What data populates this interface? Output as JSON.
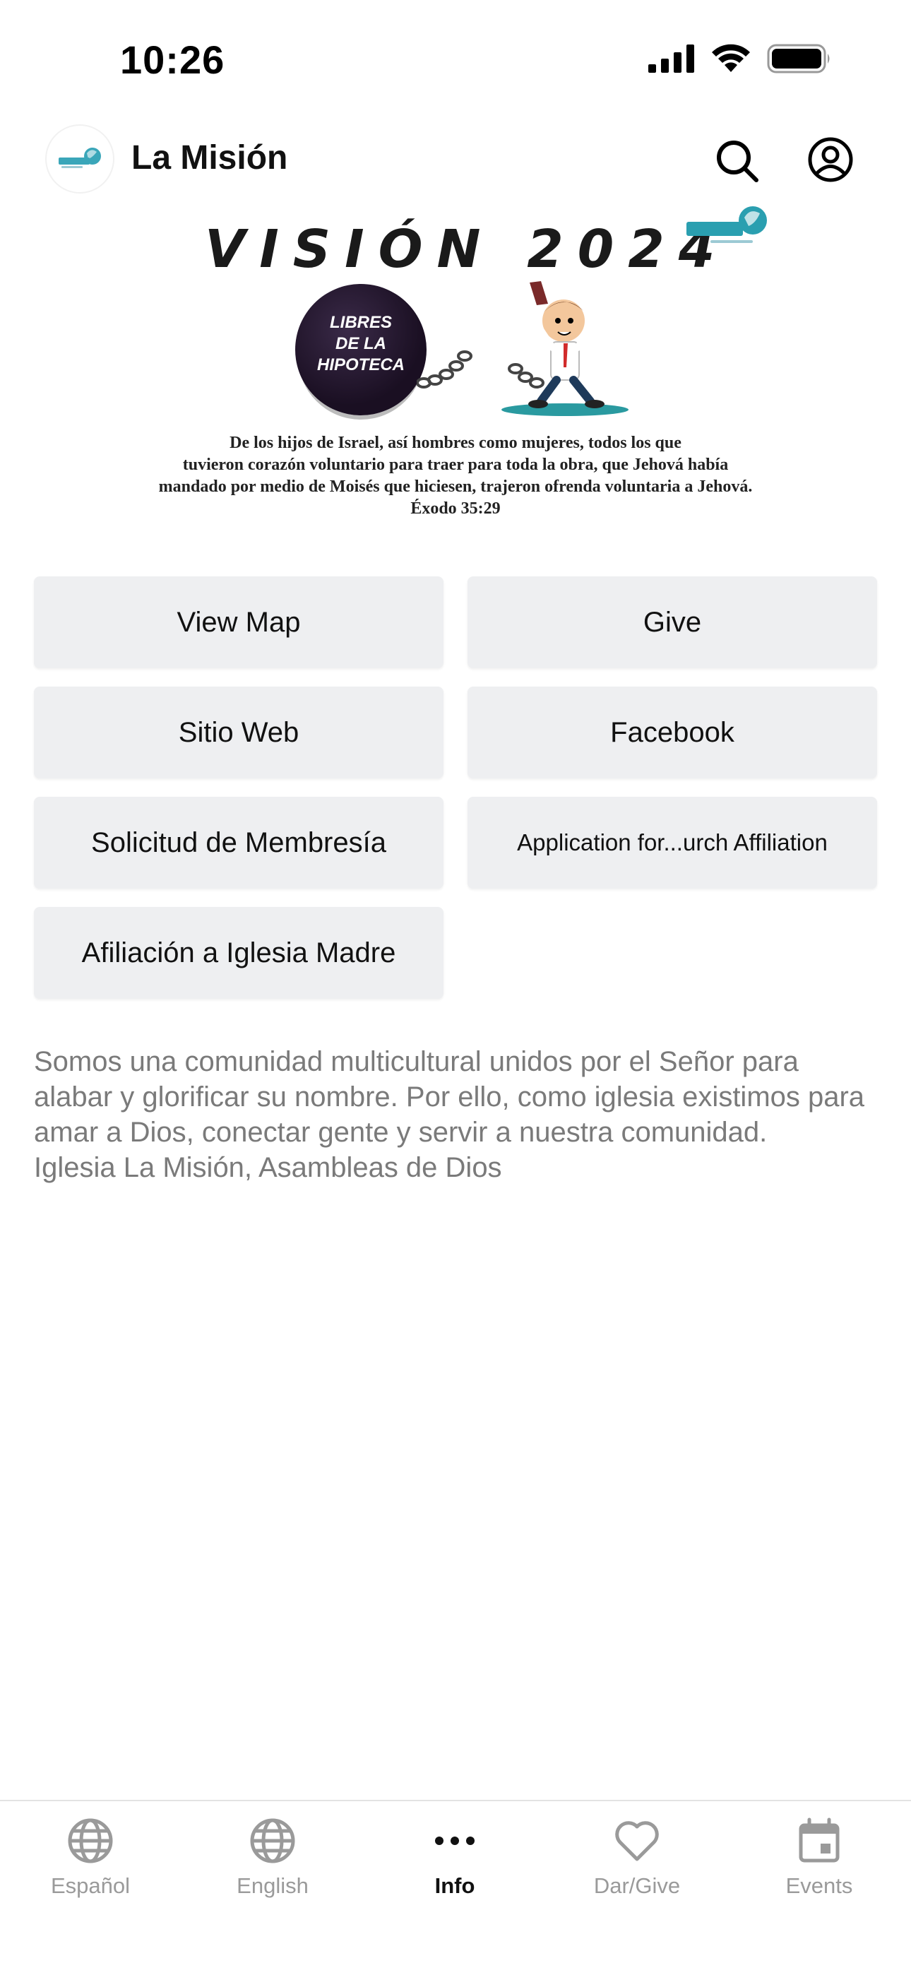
{
  "status_bar": {
    "time": "10:26"
  },
  "header": {
    "title": "La Misión"
  },
  "banner": {
    "title": "VISIÓN 2024",
    "ball_text": [
      "LIBRES",
      "DE LA",
      "HIPOTECA"
    ],
    "verse_lines": [
      "De los hijos de Israel, así hombres como mujeres, todos los que",
      "tuvieron corazón voluntario para traer para toda la obra, que Jehová había",
      "mandado por medio de Moisés que hiciesen, trajeron ofrenda voluntaria a Jehová.",
      "Éxodo 35:29"
    ]
  },
  "buttons": {
    "view_map": "View Map",
    "give": "Give",
    "sitio_web": "Sitio Web",
    "facebook": "Facebook",
    "solicitud": "Solicitud de Membresía",
    "application": "Application for...urch Affiliation",
    "afiliacion": "Afiliación a Iglesia Madre"
  },
  "description": {
    "body": "Somos una comunidad multicultural unidos por el Señor para alabar y glorificar su nombre. Por ello, como iglesia existimos para amar a Dios, conectar gente y servir a nuestra comunidad.",
    "signature": "Iglesia La Misión, Asambleas de Dios"
  },
  "tabs": [
    {
      "label": "Español",
      "icon": "globe-icon"
    },
    {
      "label": "English",
      "icon": "globe-icon"
    },
    {
      "label": "Info",
      "icon": "more-icon",
      "active": true
    },
    {
      "label": "Dar/Give",
      "icon": "heart-icon"
    },
    {
      "label": "Events",
      "icon": "calendar-icon"
    }
  ],
  "colors": {
    "button_bg": "#eeeff1",
    "text_secondary": "#7a7a7a",
    "tab_inactive": "#9a9a9a",
    "brand_teal": "#2a9fb0"
  }
}
